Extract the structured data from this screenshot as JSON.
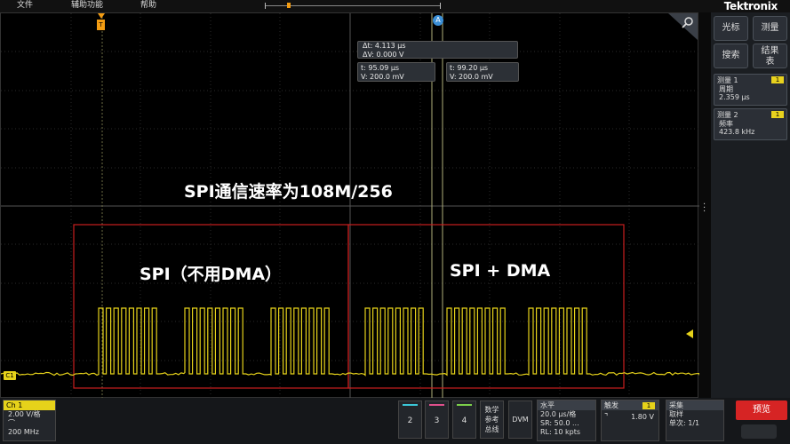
{
  "menu": {
    "items": [
      "文件",
      "辅助功能",
      "帮助"
    ]
  },
  "brand": "Tektronix",
  "right_panel": {
    "buttons": [
      {
        "label": "光标",
        "name": "cursor-button"
      },
      {
        "label": "测量",
        "name": "measure-button"
      },
      {
        "label": "搜索",
        "name": "search-button"
      },
      {
        "label": "结果表",
        "name": "results-table-button"
      }
    ],
    "measurements": [
      {
        "header": "测量 1",
        "badge": "1",
        "name": "周期",
        "value": "2.359 μs"
      },
      {
        "header": "测量 2",
        "badge": "1",
        "name": "频率",
        "value": "423.8 kHz"
      }
    ]
  },
  "cursor_readout": {
    "dt": "Δt:  4.113 μs",
    "dv": "ΔV: 0.000 V",
    "t1": "t:    95.09 μs",
    "v1": "V:   200.0 mV",
    "t2": "t:    99.20 μs",
    "v2": "V:   200.0 mV",
    "cursor_marker": "A"
  },
  "annotations": {
    "title": "SPI通信速率为108M/256",
    "left_box": "SPI（不用DMA）",
    "right_box": "SPI + DMA"
  },
  "trigger_marker": "T",
  "channel_tag": "C1",
  "bottom": {
    "ch1": {
      "title": "Ch 1",
      "scale": "2.00 V/格",
      "bw_icon": "bandwidth-icon",
      "bandwidth": "200 MHz"
    },
    "channels": [
      {
        "label": "2",
        "color": "#3bc7d8"
      },
      {
        "label": "3",
        "color": "#e0508c"
      },
      {
        "label": "4",
        "color": "#7ccf4a"
      }
    ],
    "math_ref_bus": "数学\n参考\n总线",
    "dvm": "DVM",
    "horizontal": {
      "title": "水平",
      "scale": "20.0 μs/格",
      "sr": "SR: 50.0 ...",
      "rl": "RL: 10 kpts"
    },
    "trigger": {
      "title": "触发",
      "badge": "1",
      "level": "1.80 V"
    },
    "acquire": {
      "title": "采集",
      "mode": "取样",
      "single": "单次: 1/1"
    },
    "preview": "预览"
  },
  "colors": {
    "signal": "#e6d21a",
    "box": "#c81f1f",
    "cursor_line": "#b0b07a",
    "accent": "#3b8fd6"
  }
}
